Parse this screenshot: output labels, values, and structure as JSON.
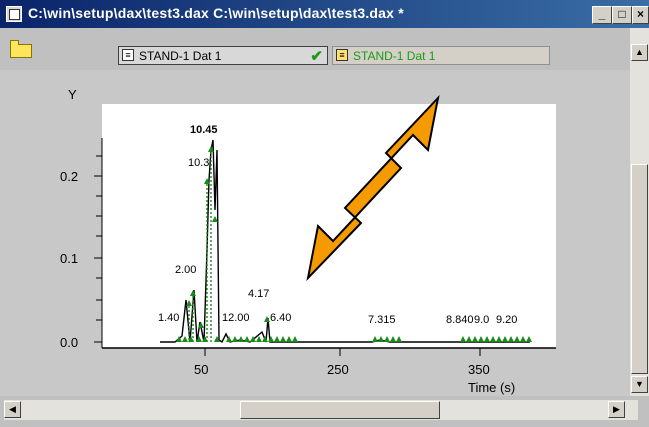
{
  "window": {
    "title": "C:\\win\\setup\\dax\\test3.dax  C:\\win\\setup\\dax\\test3.dax *",
    "minimize_label": "_",
    "maximize_label": "□",
    "close_label": "×"
  },
  "toolbar": {
    "tab1_label": "STAND-1 Dat 1",
    "tab2_label": "STAND-1 Dat 1"
  },
  "chart_data": {
    "type": "line",
    "ylabel": "Y",
    "xlabel": "Time (s)",
    "y_ticks": [
      "0.0",
      "0.1",
      "0.2"
    ],
    "x_ticks": [
      "50",
      "250",
      "350"
    ],
    "peak_labels": [
      "10.45",
      "10.3",
      "2.00",
      "4.17",
      "1.40",
      "12.00",
      "6.40",
      "7.315",
      "8.840",
      "9.0",
      "9.20"
    ],
    "colors": {
      "trace": "#000000",
      "markers": "#1a8a1a",
      "arrow": "#f5a000"
    }
  }
}
